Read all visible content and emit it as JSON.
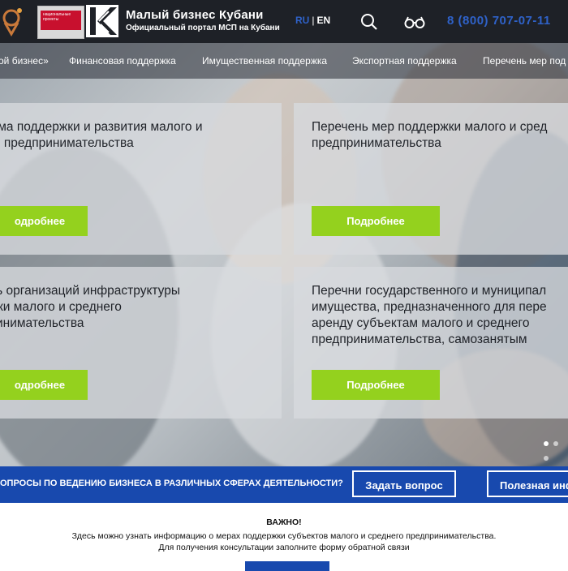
{
  "header": {
    "brand_title": "Малый бизнес Кубани",
    "brand_subtitle": "Официальный портал МСП на Кубани",
    "lang_ru": "RU",
    "lang_sep": "|",
    "lang_en": "EN",
    "phone": "8 (800) 707-07-11",
    "badge_text": "национальные проекты"
  },
  "nav": {
    "items": [
      "ой бизнес»",
      "Финансовая поддержка",
      "Имущественная поддержка",
      "Экспортная поддержка",
      "Перечень мер под"
    ]
  },
  "cards": [
    {
      "title": "амма поддержки и развития малого и\nего предпринимательства",
      "button": "одробнее"
    },
    {
      "title": "Перечень мер поддержки малого и сред\nпредпринимательства",
      "button": "Подробнее"
    },
    {
      "title": "ень организаций инфраструктуры\nржки малого и среднего\nпринимательства",
      "button": "одробнее"
    },
    {
      "title": "Перечни государственного и муниципал\nимущества, предназначенного для пере\nаренду субъектам малого и среднего\nпредпринимательства, самозанятым",
      "button": "Подробнее"
    }
  ],
  "questions": {
    "text": "ОПРОСЫ ПО ВЕДЕНИЮ БИЗНЕСА В РАЗЛИЧНЫХ СФЕРАХ ДЕЯТЕЛЬНОСТИ?",
    "ask_button": "Задать вопрос",
    "useful_button": "Полезная инф"
  },
  "notice": {
    "heading": "ВАЖНО!",
    "line1": "Здесь можно узнать информацию о мерах поддержки субъектов малого и среднего предпринимательства.",
    "line2": "Для получения консультации заполните форму обратной связи"
  },
  "colors": {
    "header_bg": "#1e2127",
    "accent_blue": "#2f62c9",
    "button_green": "#94d11e",
    "strip_blue": "#1849ae"
  }
}
